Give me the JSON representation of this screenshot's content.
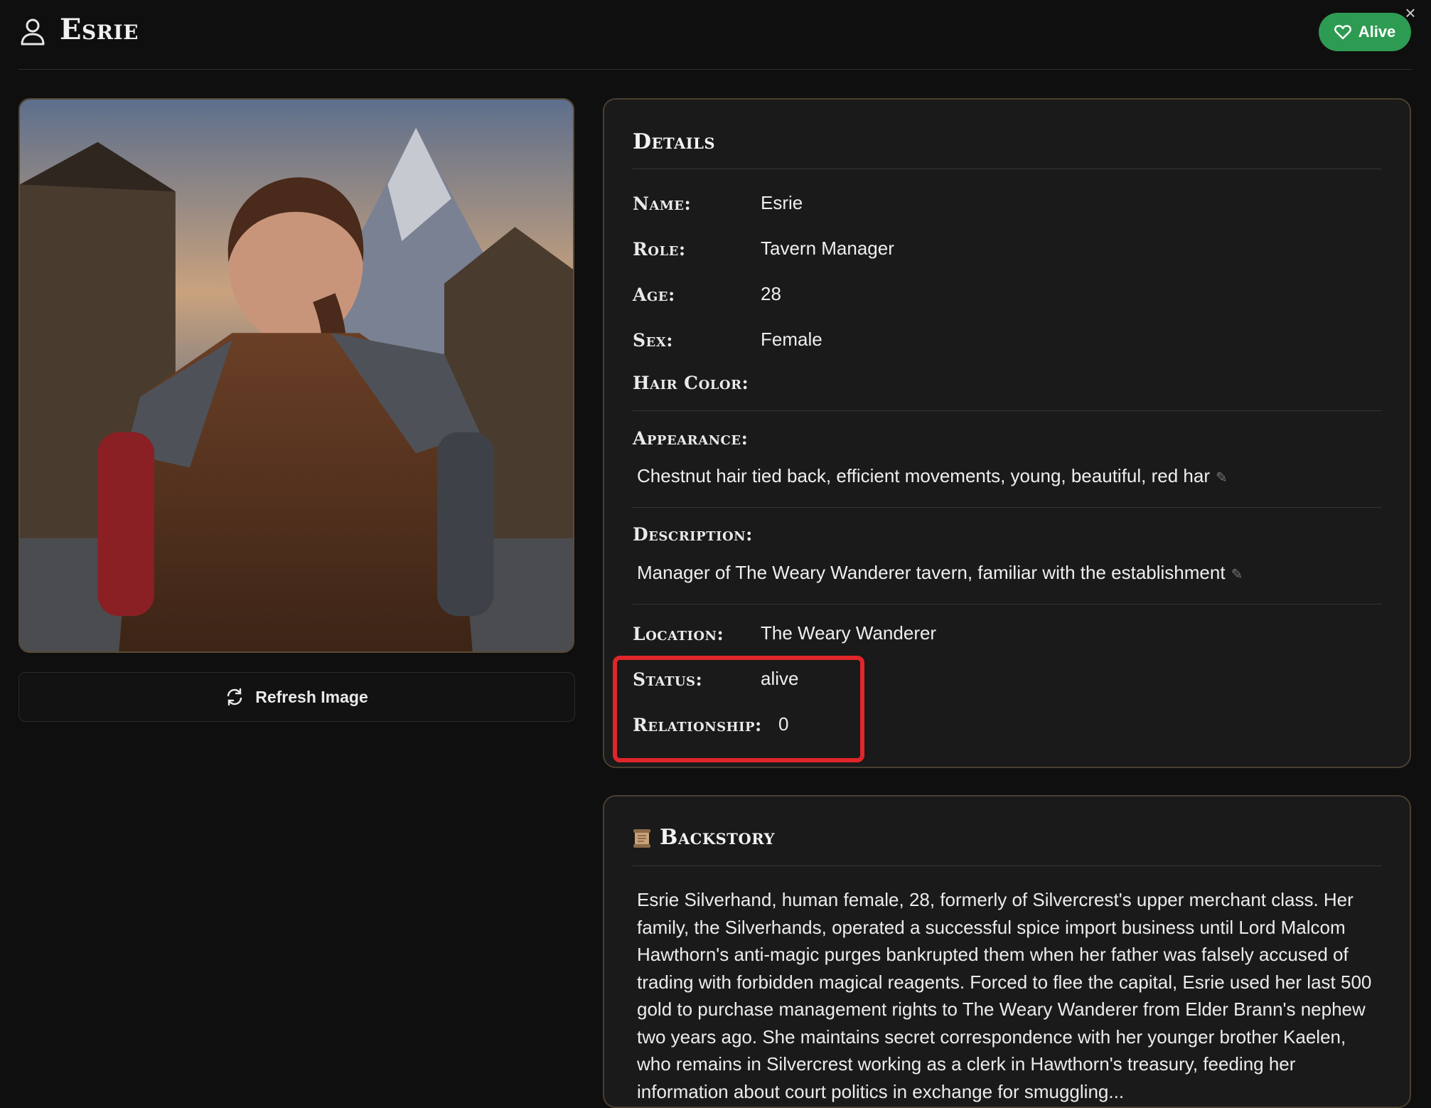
{
  "header": {
    "title": "Esrie",
    "status_badge": "Alive",
    "colors": {
      "badge": "#2e9b52",
      "highlight": "#e0262a",
      "card_border": "#4a3f30"
    }
  },
  "portrait": {
    "refresh_label": "Refresh Image"
  },
  "details": {
    "heading": "Details",
    "fields": [
      {
        "label": "Name:",
        "value": "Esrie"
      },
      {
        "label": "Role:",
        "value": "Tavern Manager"
      },
      {
        "label": "Age:",
        "value": "28"
      },
      {
        "label": "Sex:",
        "value": "Female"
      },
      {
        "label": "Hair Color:",
        "value": ""
      }
    ],
    "appearance": {
      "label": "Appearance:",
      "text": "Chestnut hair tied back, efficient movements, young, beautiful, red har"
    },
    "description": {
      "label": "Description:",
      "text": "Manager of The Weary Wanderer tavern, familiar with the establishment"
    },
    "location": {
      "label": "Location:",
      "value": "The Weary Wanderer"
    },
    "status": {
      "label": "Status:",
      "value": "alive"
    },
    "relationship": {
      "label": "Relationship:",
      "value": "0"
    }
  },
  "backstory": {
    "heading": "Backstory",
    "text": "Esrie Silverhand, human female, 28, formerly of Silvercrest's upper merchant class. Her family, the Silverhands, operated a successful spice import business until Lord Malcom Hawthorn's anti-magic purges bankrupted them when her father was falsely accused of trading with forbidden magical reagents. Forced to flee the capital, Esrie used her last 500 gold to purchase management rights to The Weary Wanderer from Elder Brann's nephew two years ago. She maintains secret correspondence with her younger brother Kaelen, who remains in Silvercrest working as a clerk in Hawthorn's treasury, feeding her information about court politics in exchange for smuggling..."
  }
}
